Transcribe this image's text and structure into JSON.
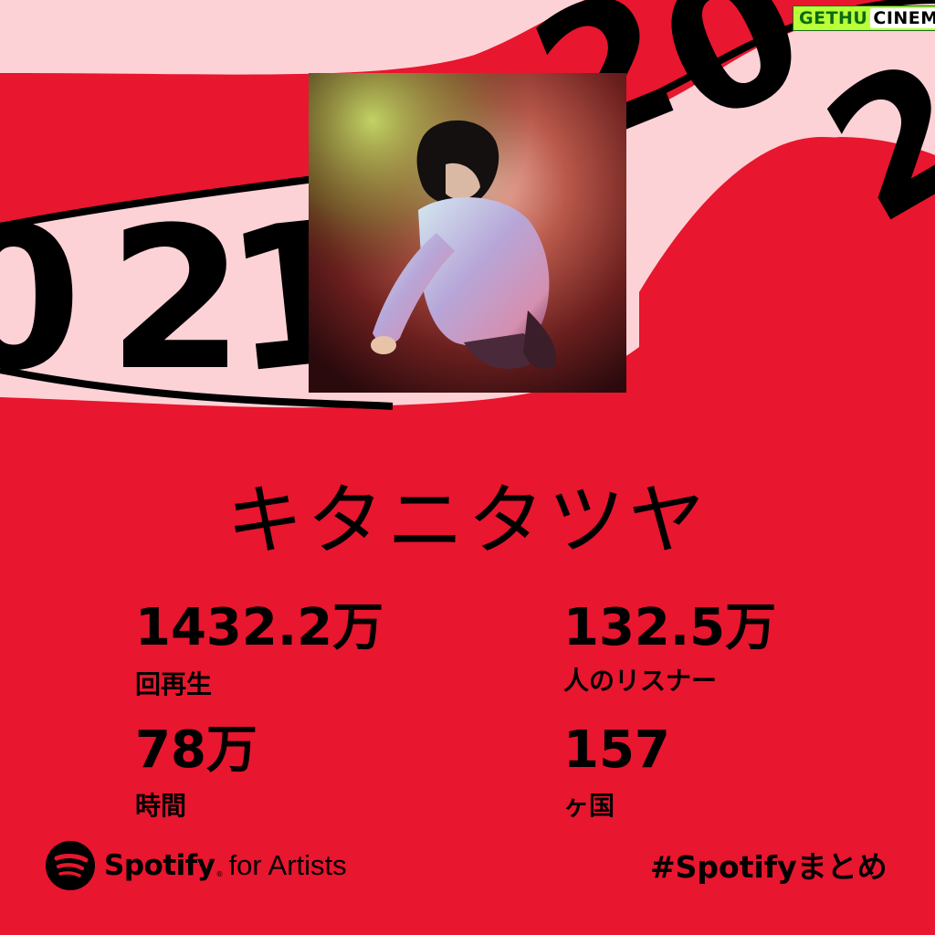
{
  "background": {
    "color": "#e8162e",
    "ribbon_color": "#fcd2d6",
    "year_digits": [
      "0",
      "2",
      "1",
      "2",
      "0",
      "2"
    ]
  },
  "watermark": {
    "part_a": "GETHU",
    "part_b": "CINEMA"
  },
  "photo": {
    "icon": "artist-photo"
  },
  "artist": {
    "name": "キタニタツヤ"
  },
  "stats": [
    {
      "value": "1432.2万",
      "label": "回再生"
    },
    {
      "value": "132.5万",
      "label": "人のリスナー"
    },
    {
      "value": "78万",
      "label": "時間"
    },
    {
      "value": "157",
      "label": "ヶ国"
    }
  ],
  "brand": {
    "icon": "spotify-logo-icon",
    "name": "Spotify",
    "reg": "®",
    "suffix": "for Artists"
  },
  "hashtag": "#Spotifyまとめ"
}
